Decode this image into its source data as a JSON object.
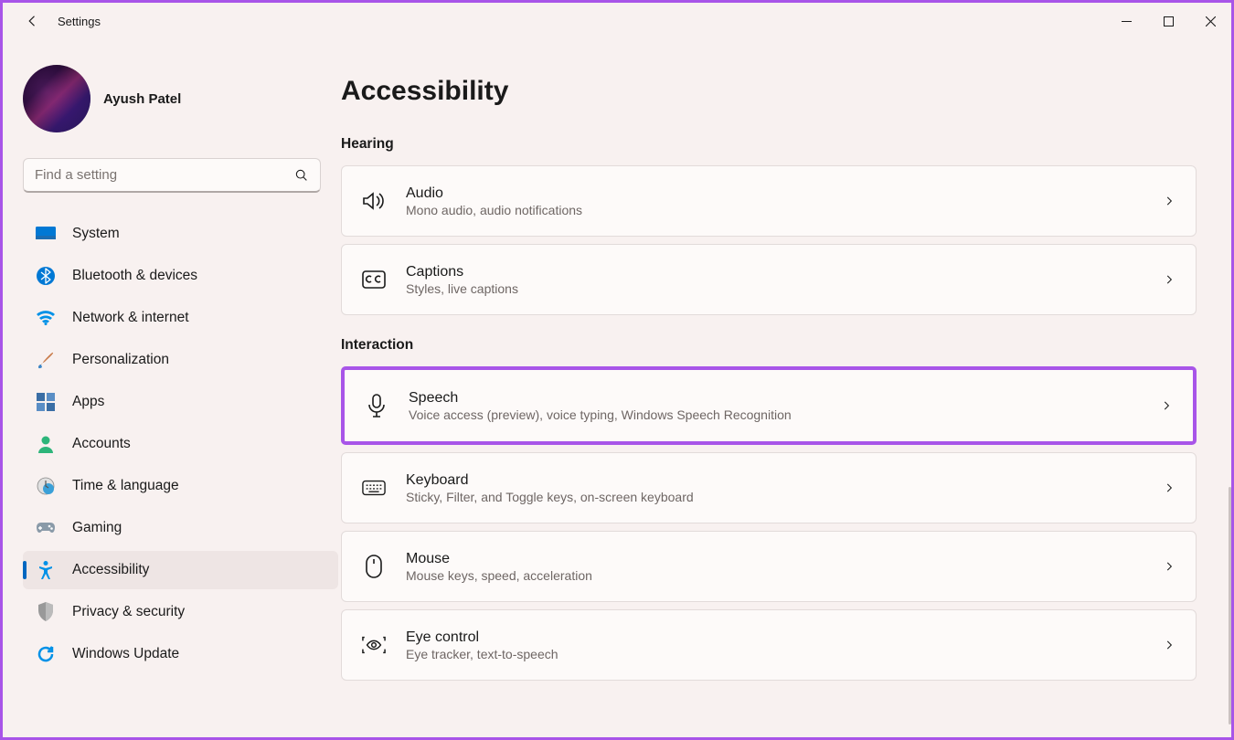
{
  "app_title": "Settings",
  "user": {
    "name": "Ayush Patel"
  },
  "search": {
    "placeholder": "Find a setting"
  },
  "nav": {
    "items": [
      {
        "id": "system",
        "label": "System"
      },
      {
        "id": "bluetooth",
        "label": "Bluetooth & devices"
      },
      {
        "id": "network",
        "label": "Network & internet"
      },
      {
        "id": "personalization",
        "label": "Personalization"
      },
      {
        "id": "apps",
        "label": "Apps"
      },
      {
        "id": "accounts",
        "label": "Accounts"
      },
      {
        "id": "time",
        "label": "Time & language"
      },
      {
        "id": "gaming",
        "label": "Gaming"
      },
      {
        "id": "accessibility",
        "label": "Accessibility"
      },
      {
        "id": "privacy",
        "label": "Privacy & security"
      },
      {
        "id": "update",
        "label": "Windows Update"
      }
    ]
  },
  "main": {
    "title": "Accessibility",
    "sections": {
      "hearing": {
        "label": "Hearing",
        "audio": {
          "title": "Audio",
          "sub": "Mono audio, audio notifications"
        },
        "captions": {
          "title": "Captions",
          "sub": "Styles, live captions"
        }
      },
      "interaction": {
        "label": "Interaction",
        "speech": {
          "title": "Speech",
          "sub": "Voice access (preview), voice typing, Windows Speech Recognition"
        },
        "keyboard": {
          "title": "Keyboard",
          "sub": "Sticky, Filter, and Toggle keys, on-screen keyboard"
        },
        "mouse": {
          "title": "Mouse",
          "sub": "Mouse keys, speed, acceleration"
        },
        "eye": {
          "title": "Eye control",
          "sub": "Eye tracker, text-to-speech"
        }
      }
    }
  }
}
